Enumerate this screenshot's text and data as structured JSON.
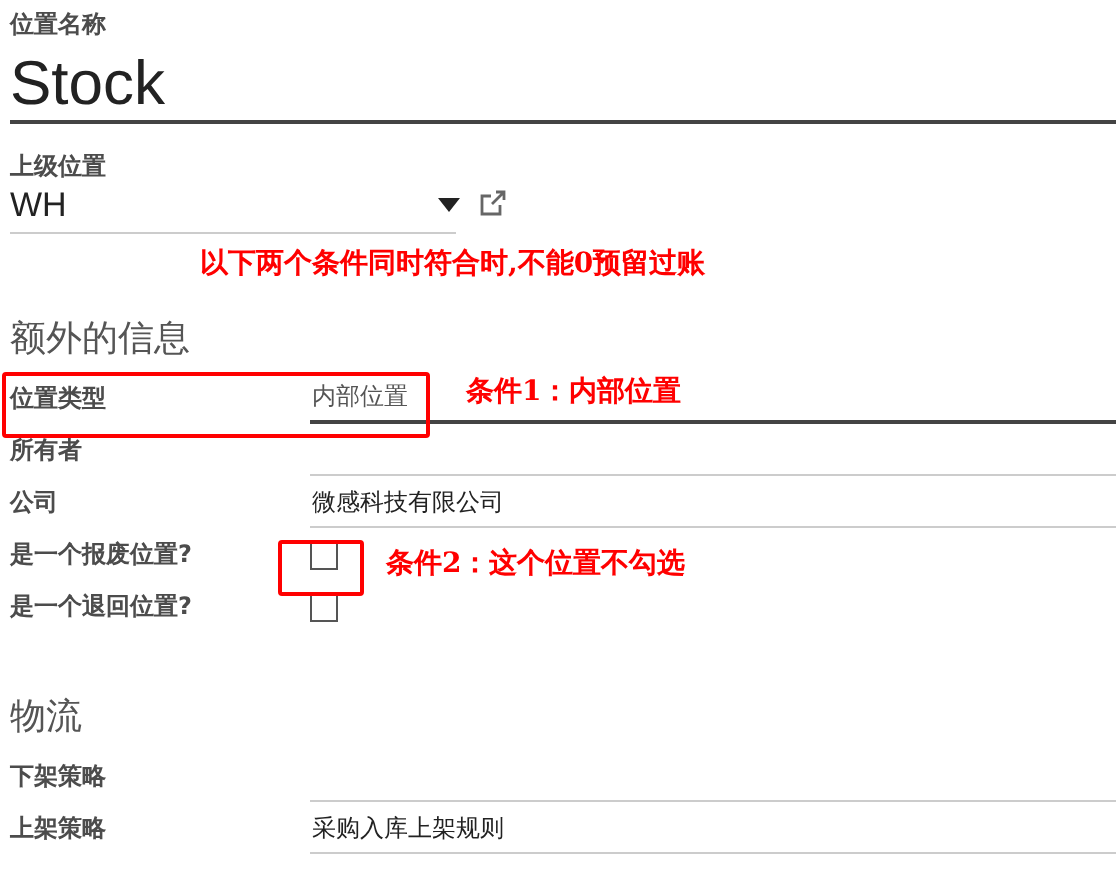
{
  "name_field": {
    "label": "位置名称",
    "value": "Stock"
  },
  "parent_field": {
    "label": "上级位置",
    "value": "WH"
  },
  "sections": [
    {
      "title": "额外的信息",
      "fields": [
        {
          "kind": "select",
          "label": "位置类型",
          "value": "内部位置"
        },
        {
          "kind": "text",
          "label": "所有者"
        },
        {
          "kind": "text",
          "label": "公司",
          "value": "微感科技有限公司"
        },
        {
          "kind": "checkbox",
          "label": "是一个报废位置?",
          "checked": false
        },
        {
          "kind": "checkbox",
          "label": "是一个退回位置?",
          "checked": false
        }
      ]
    },
    {
      "title": "物流",
      "fields": [
        {
          "kind": "text",
          "label": "下架策略"
        },
        {
          "kind": "text",
          "label": "上架策略",
          "value": "采购入库上架规则"
        }
      ]
    }
  ],
  "annotations": [
    {
      "text": "以下两个条件同时符合时,不能0预留过账"
    },
    {
      "text": "条件1：内部位置"
    },
    {
      "text": "条件2：这个位置不勾选"
    }
  ]
}
